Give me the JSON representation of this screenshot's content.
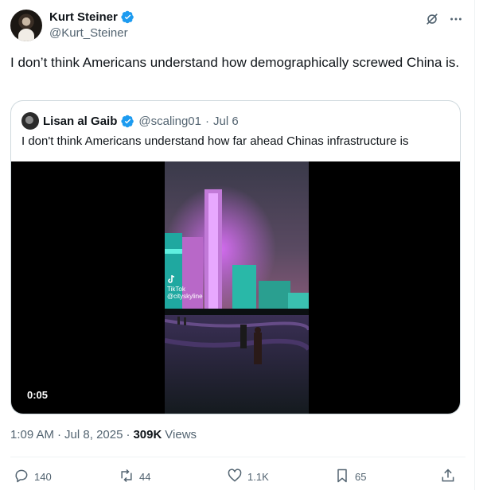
{
  "author": {
    "name": "Kurt Steiner",
    "handle": "@Kurt_Steiner"
  },
  "tweet": {
    "text": "I don’t think Americans understand how demographically screwed China is."
  },
  "quoted": {
    "name": "Lisan al Gaib",
    "handle": "@scaling01",
    "separator": "·",
    "date": "Jul 6",
    "text": "I don't think Americans understand how far ahead Chinas infrastructure is",
    "video": {
      "duration": "0:05",
      "watermark_brand": "TikTok",
      "watermark_user": "@cityskyline"
    }
  },
  "meta": {
    "time": "1:09 AM",
    "separator1": "·",
    "date": "Jul 8, 2025",
    "separator2": "·",
    "views_count": "309K",
    "views_label": "Views"
  },
  "actions": {
    "replies": "140",
    "reposts": "44",
    "likes": "1.1K",
    "bookmarks": "65"
  },
  "icons": [
    "verified-badge-icon",
    "grok-icon",
    "more-icon",
    "reply-icon",
    "repost-icon",
    "like-icon",
    "bookmark-icon",
    "share-icon",
    "tiktok-icon"
  ],
  "colors": {
    "verified": "#1d9bf0",
    "secondary_text": "#536471",
    "primary_text": "#0f1419",
    "border": "#cfd9de"
  }
}
